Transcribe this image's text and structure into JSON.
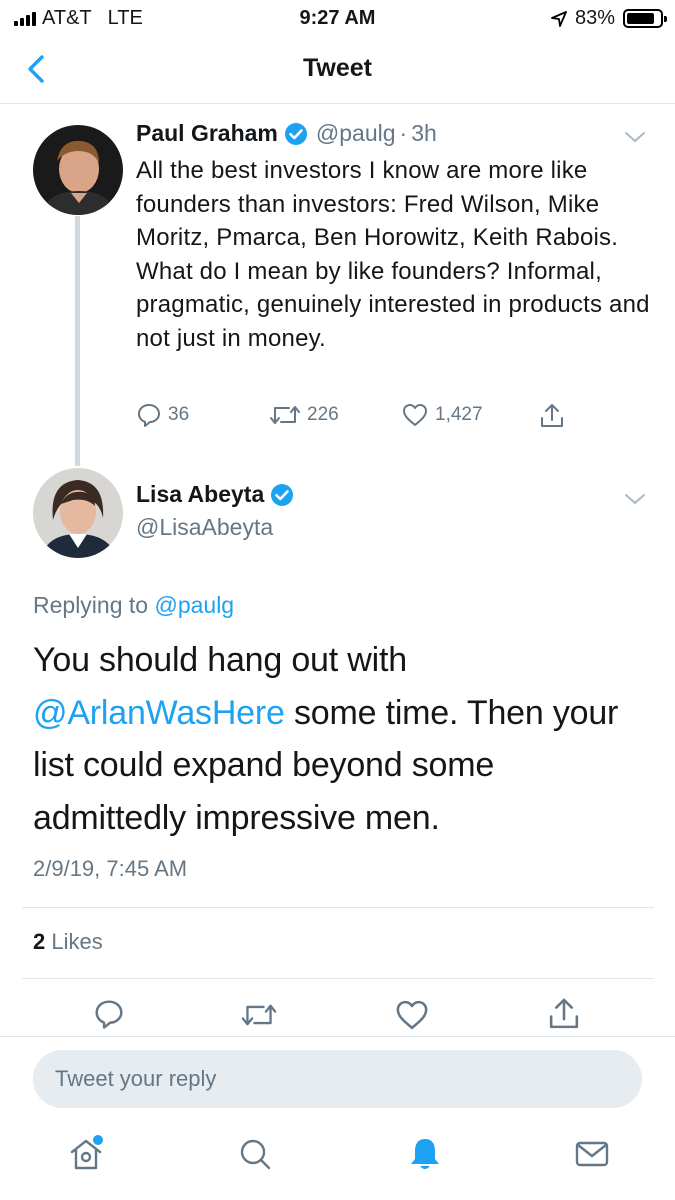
{
  "status": {
    "carrier": "AT&T",
    "network": "LTE",
    "time": "9:27 AM",
    "battery": "83%",
    "battery_level": 0.83
  },
  "nav": {
    "title": "Tweet",
    "back_icon": "chevron-left-icon"
  },
  "parent_tweet": {
    "name": "Paul Graham",
    "handle": "@paulg",
    "separator": "·",
    "age": "3h",
    "text": "All the best investors I know are more like founders than investors: Fred Wilson, Mike Moritz, Pmarca, Ben Horowitz, Keith Rabois. What do I mean by like founders? Informal, pragmatic, genuinely interested in products and not just in money.",
    "replies": "36",
    "retweets": "226",
    "likes": "1,427"
  },
  "reply_tweet": {
    "name": "Lisa Abeyta",
    "handle": "@LisaAbeyta",
    "replying_prefix": "Replying to",
    "replying_to": "@paulg",
    "text_mention": "@ArlanWasHere",
    "text_before": "You should hang out with",
    "text_after": "some time. Then your list could expand beyond some admittedly impressive men.",
    "timestamp": "2/9/19, 7:45 AM",
    "likes_count": "2",
    "likes_label": "Likes"
  },
  "compose": {
    "placeholder": "Tweet your reply"
  },
  "tabs": [
    {
      "icon": "home-icon",
      "has_dot": true
    },
    {
      "icon": "search-icon"
    },
    {
      "icon": "notifications-icon",
      "active": true
    },
    {
      "icon": "messages-icon"
    }
  ],
  "colors": {
    "accent": "#1da1f2",
    "muted": "#657786",
    "text": "#14171a"
  }
}
